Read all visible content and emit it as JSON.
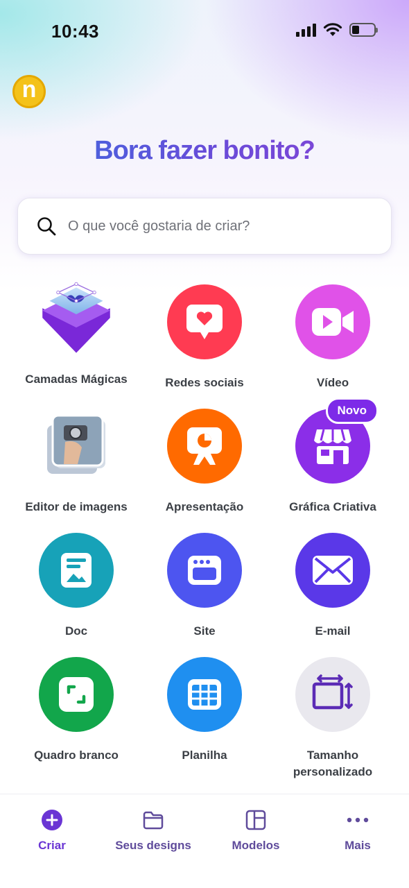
{
  "status_bar": {
    "time": "10:43"
  },
  "header": {
    "avatar_letter": "n",
    "headline": "Bora fazer bonito?"
  },
  "search": {
    "placeholder": "O que você gostaria de criar?"
  },
  "categories": [
    {
      "label": "Camadas Mágicas",
      "icon": "magic-layers-icon"
    },
    {
      "label": "Redes sociais",
      "icon": "heart-chat-icon",
      "color": "#ff3b52"
    },
    {
      "label": "Vídeo",
      "icon": "video-camera-icon",
      "color": "#e052e8"
    },
    {
      "label": "Editor de imagens",
      "icon": "photo-stack-icon"
    },
    {
      "label": "Apresentação",
      "icon": "presentation-icon",
      "color": "#ff6a00"
    },
    {
      "label": "Gráfica Criativa",
      "icon": "storefront-icon",
      "color": "#8b2ee8",
      "badge": "Novo"
    },
    {
      "label": "Doc",
      "icon": "document-icon",
      "color": "#17a2b8"
    },
    {
      "label": "Site",
      "icon": "browser-window-icon",
      "color": "#4d55f0"
    },
    {
      "label": "E-mail",
      "icon": "envelope-icon",
      "color": "#5a38e8"
    },
    {
      "label": "Quadro branco",
      "icon": "whiteboard-icon",
      "color": "#12a64b"
    },
    {
      "label": "Planilha",
      "icon": "spreadsheet-icon",
      "color": "#1f8ff0"
    },
    {
      "label": "Tamanho personalizado",
      "icon": "resize-icon",
      "color": "#e9e8ee"
    }
  ],
  "bottom_nav": [
    {
      "label": "Criar",
      "icon": "plus-circle-icon",
      "active": true
    },
    {
      "label": "Seus designs",
      "icon": "folder-icon"
    },
    {
      "label": "Modelos",
      "icon": "templates-icon"
    },
    {
      "label": "Mais",
      "icon": "more-dots-icon"
    }
  ],
  "colors": {
    "accent": "#7d2ae8",
    "nav_text": "#5f4b9b"
  }
}
